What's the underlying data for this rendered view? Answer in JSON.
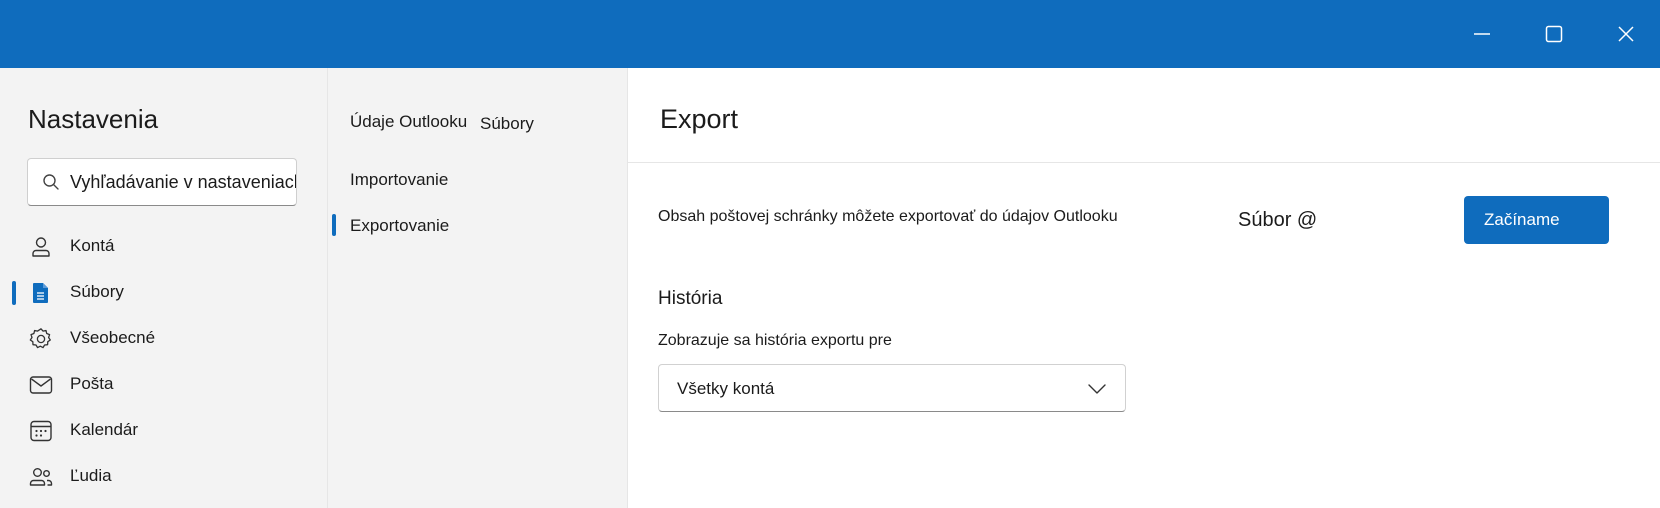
{
  "window": {
    "controls": {
      "minimize_icon": "minimize-icon",
      "maximize_icon": "maximize-icon",
      "close_icon": "close-icon"
    },
    "titlebar_color": "#0f6cbd"
  },
  "settings": {
    "title": "Nastavenia",
    "search": {
      "placeholder": "Vyhľadávanie v nastaveniach",
      "value": ""
    },
    "nav": [
      {
        "label": "Kontá",
        "icon": "person-icon",
        "selected": false
      },
      {
        "label": "Súbory",
        "icon": "document-icon",
        "selected": true
      },
      {
        "label": "Všeobecné",
        "icon": "gear-icon",
        "selected": false
      },
      {
        "label": "Pošta",
        "icon": "mail-icon",
        "selected": false
      },
      {
        "label": "Kalendár",
        "icon": "calendar-icon",
        "selected": false
      },
      {
        "label": "Ľudia",
        "icon": "people-icon",
        "selected": false
      }
    ]
  },
  "subnav": {
    "group_header": "Údaje Outlooku",
    "group_header_secondary": "Súbory",
    "items": [
      {
        "label": "Importovanie",
        "selected": false
      },
      {
        "label": "Exportovanie",
        "selected": true
      }
    ]
  },
  "content": {
    "title": "Export",
    "export_description": "Obsah poštovej schránky môžete exportovať do údajov Outlooku",
    "export_target": "Súbor @",
    "start_button": "Začíname",
    "history": {
      "title": "História",
      "label": "Zobrazuje sa história exportu pre",
      "selected_account": "Všetky kontá"
    }
  },
  "colors": {
    "accent": "#0f6cbd",
    "pane_background": "#f3f3f3"
  }
}
